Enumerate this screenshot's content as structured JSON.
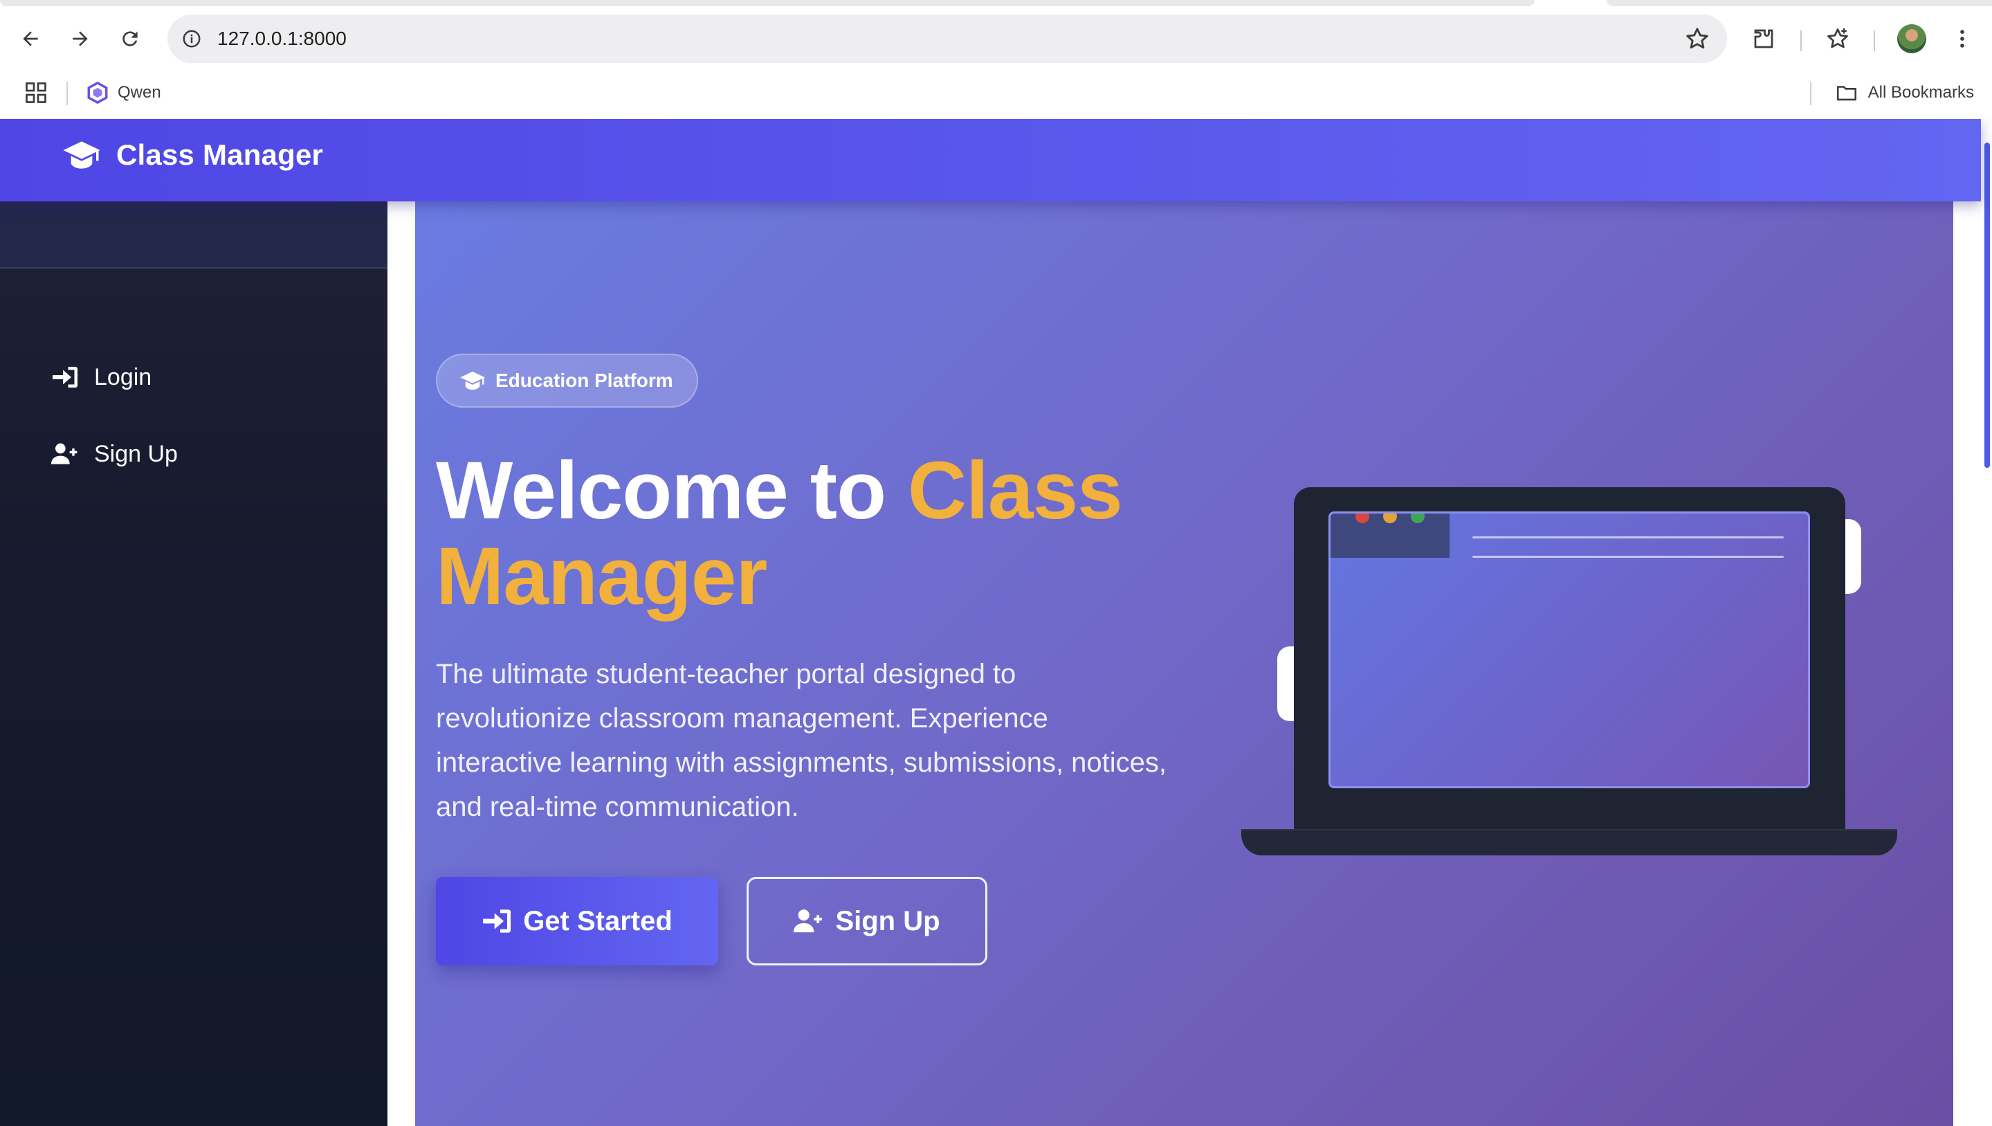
{
  "browser": {
    "url": "127.0.0.1:8000",
    "bookmarks": [
      {
        "label": "Qwen"
      }
    ],
    "all_bookmarks_label": "All Bookmarks"
  },
  "header": {
    "brand": "Class Manager",
    "brand_icon": "graduation-cap-icon",
    "color_start": "#4f46e5",
    "color_end": "#6366f1"
  },
  "sidebar": {
    "items": [
      {
        "label": "Login",
        "icon": "sign-in-icon"
      },
      {
        "label": "Sign Up",
        "icon": "user-plus-icon"
      }
    ]
  },
  "hero": {
    "badge": "Education Platform",
    "title_plain": "Welcome to ",
    "title_accent": "Class Manager",
    "accent_color": "#f2b13c",
    "description": "The ultimate student-teacher portal designed to revolutionize classroom management. Experience interactive learning with assignments, submissions, notices, and real-time communication.",
    "primary_button": "Get Started",
    "secondary_button": "Sign Up"
  }
}
